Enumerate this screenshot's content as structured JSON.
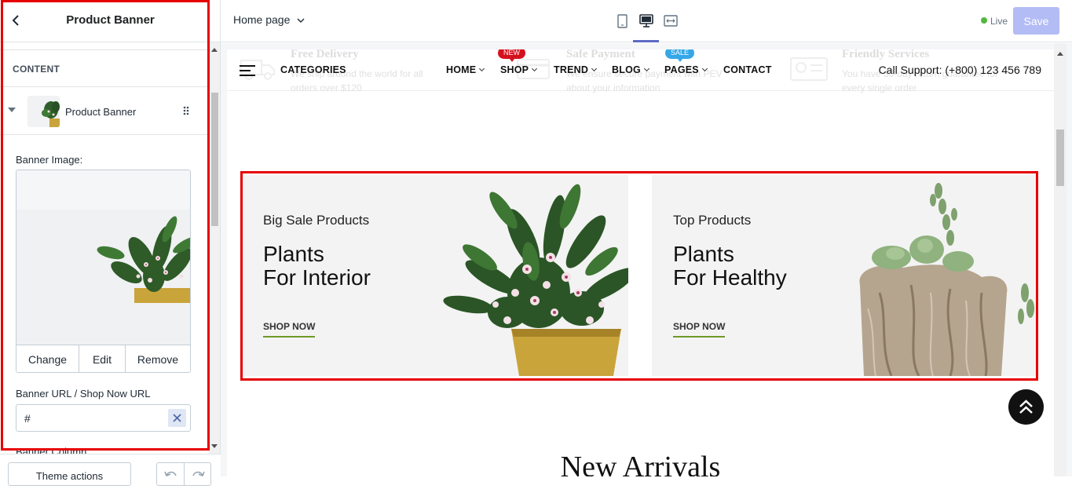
{
  "sidebar": {
    "title": "Product Banner",
    "section_title": "CONTENT",
    "block_label": "Product Banner",
    "banner_image_label": "Banner Image:",
    "image_actions": {
      "change": "Change",
      "edit": "Edit",
      "remove": "Remove"
    },
    "url_label": "Banner URL / Shop Now URL",
    "url_value": "#",
    "next_field_label": "Banner Column",
    "footer": {
      "theme_actions": "Theme actions"
    }
  },
  "topbar": {
    "page_selector": "Home page",
    "status": "Live",
    "save_label": "Save",
    "status_color": "#50b83c",
    "accent": "#5c6ac4"
  },
  "preview": {
    "features": [
      {
        "title": "Free Delivery",
        "text1": "We ship around the world for all",
        "text2": "orders over $120"
      },
      {
        "title": "Safe Payment",
        "text1": "We ensure secure payment with PEV",
        "text2": "about your information"
      },
      {
        "title": "Friendly Services",
        "text1": "You have 30-day return guarantee for",
        "text2": "every single order"
      }
    ],
    "nav": {
      "categories": "CATEGORIES",
      "items": [
        "HOME",
        "SHOP",
        "TREND",
        "BLOG",
        "PAGES",
        "CONTACT"
      ],
      "badge_new": "NEW",
      "badge_sale": "SALE",
      "call_support": "Call Support: (+800) 123 456 789"
    },
    "banners": [
      {
        "subtitle": "Big Sale Products",
        "title_line1": "Plants",
        "title_line2": "For Interior",
        "cta": "SHOP NOW"
      },
      {
        "subtitle": "Top Products",
        "title_line1": "Plants",
        "title_line2": "For Healthy",
        "cta": "SHOP NOW"
      }
    ],
    "section_heading": "New Arrivals"
  }
}
